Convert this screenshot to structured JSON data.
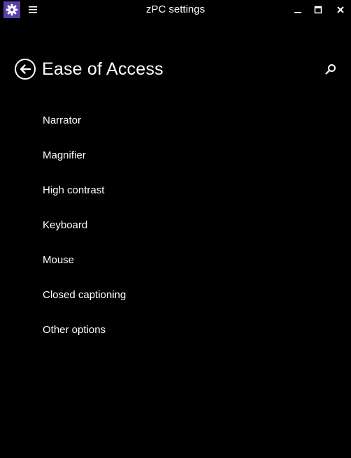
{
  "window": {
    "title": "zPC settings",
    "icons": {
      "app": "gear-icon",
      "menu": "hamburger-menu-icon",
      "minimize": "minimize-icon",
      "maximize": "maximize-icon",
      "close": "close-icon"
    }
  },
  "header": {
    "title": "Ease of Access",
    "back_icon": "back-arrow-icon",
    "search_icon": "search-icon"
  },
  "menu": {
    "items": [
      "Narrator",
      "Magnifier",
      "High contrast",
      "Keyboard",
      "Mouse",
      "Closed captioning",
      "Other options"
    ]
  },
  "colors": {
    "background": "#000000",
    "text": "#ffffff",
    "accent": "#5b3fa8"
  }
}
